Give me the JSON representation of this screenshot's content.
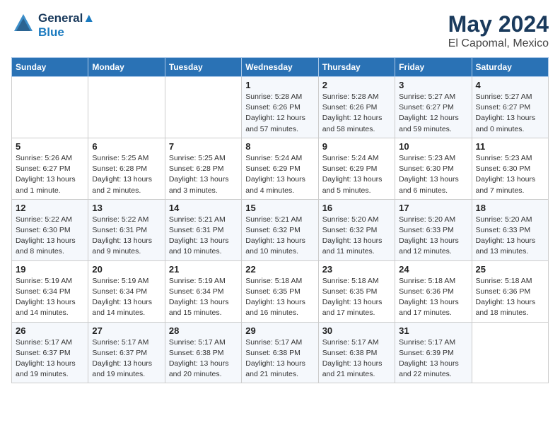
{
  "logo": {
    "line1": "General",
    "line2": "Blue"
  },
  "title": "May 2024",
  "subtitle": "El Capomal, Mexico",
  "headers": [
    "Sunday",
    "Monday",
    "Tuesday",
    "Wednesday",
    "Thursday",
    "Friday",
    "Saturday"
  ],
  "weeks": [
    [
      {
        "day": "",
        "info": ""
      },
      {
        "day": "",
        "info": ""
      },
      {
        "day": "",
        "info": ""
      },
      {
        "day": "1",
        "info": "Sunrise: 5:28 AM\nSunset: 6:26 PM\nDaylight: 12 hours\nand 57 minutes."
      },
      {
        "day": "2",
        "info": "Sunrise: 5:28 AM\nSunset: 6:26 PM\nDaylight: 12 hours\nand 58 minutes."
      },
      {
        "day": "3",
        "info": "Sunrise: 5:27 AM\nSunset: 6:27 PM\nDaylight: 12 hours\nand 59 minutes."
      },
      {
        "day": "4",
        "info": "Sunrise: 5:27 AM\nSunset: 6:27 PM\nDaylight: 13 hours\nand 0 minutes."
      }
    ],
    [
      {
        "day": "5",
        "info": "Sunrise: 5:26 AM\nSunset: 6:27 PM\nDaylight: 13 hours\nand 1 minute."
      },
      {
        "day": "6",
        "info": "Sunrise: 5:25 AM\nSunset: 6:28 PM\nDaylight: 13 hours\nand 2 minutes."
      },
      {
        "day": "7",
        "info": "Sunrise: 5:25 AM\nSunset: 6:28 PM\nDaylight: 13 hours\nand 3 minutes."
      },
      {
        "day": "8",
        "info": "Sunrise: 5:24 AM\nSunset: 6:29 PM\nDaylight: 13 hours\nand 4 minutes."
      },
      {
        "day": "9",
        "info": "Sunrise: 5:24 AM\nSunset: 6:29 PM\nDaylight: 13 hours\nand 5 minutes."
      },
      {
        "day": "10",
        "info": "Sunrise: 5:23 AM\nSunset: 6:30 PM\nDaylight: 13 hours\nand 6 minutes."
      },
      {
        "day": "11",
        "info": "Sunrise: 5:23 AM\nSunset: 6:30 PM\nDaylight: 13 hours\nand 7 minutes."
      }
    ],
    [
      {
        "day": "12",
        "info": "Sunrise: 5:22 AM\nSunset: 6:30 PM\nDaylight: 13 hours\nand 8 minutes."
      },
      {
        "day": "13",
        "info": "Sunrise: 5:22 AM\nSunset: 6:31 PM\nDaylight: 13 hours\nand 9 minutes."
      },
      {
        "day": "14",
        "info": "Sunrise: 5:21 AM\nSunset: 6:31 PM\nDaylight: 13 hours\nand 10 minutes."
      },
      {
        "day": "15",
        "info": "Sunrise: 5:21 AM\nSunset: 6:32 PM\nDaylight: 13 hours\nand 10 minutes."
      },
      {
        "day": "16",
        "info": "Sunrise: 5:20 AM\nSunset: 6:32 PM\nDaylight: 13 hours\nand 11 minutes."
      },
      {
        "day": "17",
        "info": "Sunrise: 5:20 AM\nSunset: 6:33 PM\nDaylight: 13 hours\nand 12 minutes."
      },
      {
        "day": "18",
        "info": "Sunrise: 5:20 AM\nSunset: 6:33 PM\nDaylight: 13 hours\nand 13 minutes."
      }
    ],
    [
      {
        "day": "19",
        "info": "Sunrise: 5:19 AM\nSunset: 6:34 PM\nDaylight: 13 hours\nand 14 minutes."
      },
      {
        "day": "20",
        "info": "Sunrise: 5:19 AM\nSunset: 6:34 PM\nDaylight: 13 hours\nand 14 minutes."
      },
      {
        "day": "21",
        "info": "Sunrise: 5:19 AM\nSunset: 6:34 PM\nDaylight: 13 hours\nand 15 minutes."
      },
      {
        "day": "22",
        "info": "Sunrise: 5:18 AM\nSunset: 6:35 PM\nDaylight: 13 hours\nand 16 minutes."
      },
      {
        "day": "23",
        "info": "Sunrise: 5:18 AM\nSunset: 6:35 PM\nDaylight: 13 hours\nand 17 minutes."
      },
      {
        "day": "24",
        "info": "Sunrise: 5:18 AM\nSunset: 6:36 PM\nDaylight: 13 hours\nand 17 minutes."
      },
      {
        "day": "25",
        "info": "Sunrise: 5:18 AM\nSunset: 6:36 PM\nDaylight: 13 hours\nand 18 minutes."
      }
    ],
    [
      {
        "day": "26",
        "info": "Sunrise: 5:17 AM\nSunset: 6:37 PM\nDaylight: 13 hours\nand 19 minutes."
      },
      {
        "day": "27",
        "info": "Sunrise: 5:17 AM\nSunset: 6:37 PM\nDaylight: 13 hours\nand 19 minutes."
      },
      {
        "day": "28",
        "info": "Sunrise: 5:17 AM\nSunset: 6:38 PM\nDaylight: 13 hours\nand 20 minutes."
      },
      {
        "day": "29",
        "info": "Sunrise: 5:17 AM\nSunset: 6:38 PM\nDaylight: 13 hours\nand 21 minutes."
      },
      {
        "day": "30",
        "info": "Sunrise: 5:17 AM\nSunset: 6:38 PM\nDaylight: 13 hours\nand 21 minutes."
      },
      {
        "day": "31",
        "info": "Sunrise: 5:17 AM\nSunset: 6:39 PM\nDaylight: 13 hours\nand 22 minutes."
      },
      {
        "day": "",
        "info": ""
      }
    ]
  ]
}
